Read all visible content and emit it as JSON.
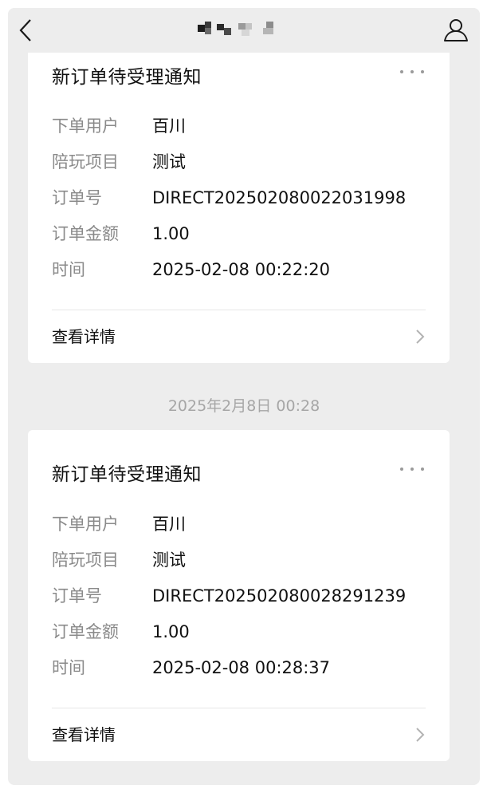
{
  "nav": {
    "back_icon": "chevron-left-icon",
    "profile_icon": "person-icon"
  },
  "messages": [
    {
      "title": "新订单待受理通知",
      "fields": [
        {
          "label": "下单用户",
          "value": "百川"
        },
        {
          "label": "陪玩项目",
          "value": "测试"
        },
        {
          "label": "订单号",
          "value": "DIRECT202502080022031998"
        },
        {
          "label": "订单金额",
          "value": "1.00"
        },
        {
          "label": "时间",
          "value": "2025-02-08 00:22:20"
        }
      ],
      "detail_label": "查看详情"
    },
    {
      "title": "新订单待受理通知",
      "fields": [
        {
          "label": "下单用户",
          "value": "百川"
        },
        {
          "label": "陪玩项目",
          "value": "测试"
        },
        {
          "label": "订单号",
          "value": "DIRECT202502080028291239"
        },
        {
          "label": "订单金额",
          "value": "1.00"
        },
        {
          "label": "时间",
          "value": "2025-02-08 00:28:37"
        }
      ],
      "detail_label": "查看详情"
    }
  ],
  "timestamp": "2025年2月8日 00:28",
  "colors": {
    "background": "#ededed",
    "card": "#ffffff",
    "label": "#8a8a8a",
    "text": "#111111",
    "timestamp": "#a6a6a6"
  }
}
